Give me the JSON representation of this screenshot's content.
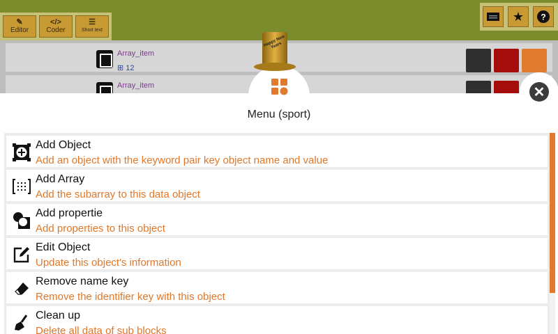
{
  "toolbar": {
    "tools": [
      {
        "label": "Editor",
        "icon": "edit-icon"
      },
      {
        "label": "Coder",
        "icon": "code-icon"
      },
      {
        "label": "Short text",
        "icon": "note-icon"
      }
    ],
    "right_icons": [
      "keyboard-icon",
      "star-icon",
      "help-icon"
    ]
  },
  "background_rows": [
    {
      "name": "Array_item",
      "count": "12"
    },
    {
      "name": "Array_item",
      "count": ""
    }
  ],
  "hat_text": "Happy New Years",
  "menu": {
    "title": "Menu (sport)",
    "items": [
      {
        "title": "Add Object",
        "desc": "Add an object with the keyword pair key object name and value",
        "icon": "add-object-icon"
      },
      {
        "title": "Add Array",
        "desc": "Add the subarray to this data object",
        "icon": "array-brackets-icon"
      },
      {
        "title": "Add propertie",
        "desc": "Add properties to this object",
        "icon": "properties-icon"
      },
      {
        "title": "Edit Object",
        "desc": "Update this object's information",
        "icon": "edit-icon"
      },
      {
        "title": "Remove name key",
        "desc": "Remove the identifier key with this object",
        "icon": "eraser-icon"
      },
      {
        "title": "Clean up",
        "desc": "Delete all data of sub blocks",
        "icon": "broom-icon"
      }
    ]
  },
  "colors": {
    "accent": "#e07a2e",
    "topbar": "#7c8b2c",
    "delete": "#a50d0d"
  }
}
